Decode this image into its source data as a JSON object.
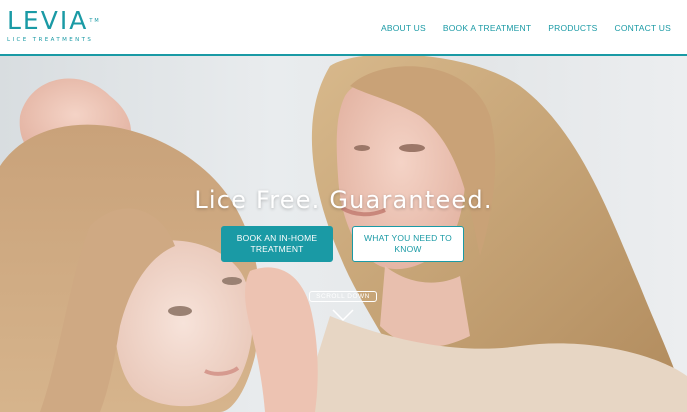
{
  "brand": {
    "name": "LEVIA",
    "tm": "TM",
    "tagline": "LICE TREATMENTS",
    "color": "#1a9aa5"
  },
  "nav": {
    "items": [
      {
        "label": "ABOUT US"
      },
      {
        "label": "BOOK A TREATMENT"
      },
      {
        "label": "PRODUCTS"
      },
      {
        "label": "CONTACT US"
      }
    ]
  },
  "hero": {
    "headline": "Lice Free. Guaranteed.",
    "primary_button": "BOOK AN IN-HOME TREATMENT",
    "secondary_button": "WHAT YOU NEED TO KNOW",
    "scroll_label": "SCROLL DOWN",
    "scroll_icon": "chevron-down-icon"
  }
}
